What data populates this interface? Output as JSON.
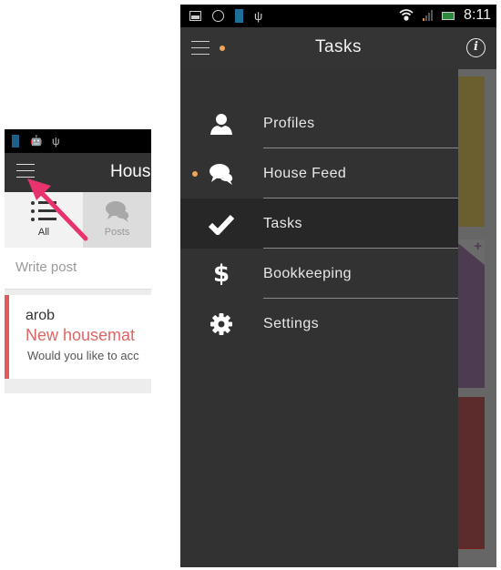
{
  "mini_screen": {
    "status_icons": [
      "sim-icon",
      "android-icon",
      "usb-icon"
    ],
    "app_title": "Hous",
    "tabs": [
      {
        "label": "All",
        "icon": "list-icon",
        "active": true
      },
      {
        "label": "Posts",
        "icon": "chat-bubbles-icon",
        "active": false
      }
    ],
    "write_post_placeholder": "Write post",
    "post": {
      "author": "arob",
      "title": "New housemat",
      "body": "Would you like to acc"
    },
    "annotation": "arrow pointing to menu button",
    "accent_color": "#e8336d"
  },
  "status_bar": {
    "left_icons": [
      "gallery-icon",
      "whatsapp-icon",
      "sim-icon",
      "usb-icon"
    ],
    "right_icons": [
      "wifi-icon",
      "signal-icon",
      "battery-icon"
    ],
    "time": "8:11"
  },
  "app_bar": {
    "title": "Tasks",
    "notification_dot_color": "#f0a55a"
  },
  "drawer": {
    "items": [
      {
        "label": "Profiles",
        "icon": "person-icon",
        "active": false,
        "notification": false
      },
      {
        "label": "House Feed",
        "icon": "chat-bubbles-icon",
        "active": false,
        "notification": true
      },
      {
        "label": "Tasks",
        "icon": "checkmark-icon",
        "active": true,
        "notification": false
      },
      {
        "label": "Bookkeeping",
        "icon": "dollar-icon",
        "active": false,
        "notification": false
      },
      {
        "label": "Settings",
        "icon": "gear-icon",
        "active": false,
        "notification": false
      }
    ]
  },
  "background_cards": [
    {
      "color": "#6b5f30"
    },
    {
      "color": "#4d3b52",
      "add_label": "+"
    },
    {
      "color": "#5c2b2c"
    }
  ]
}
